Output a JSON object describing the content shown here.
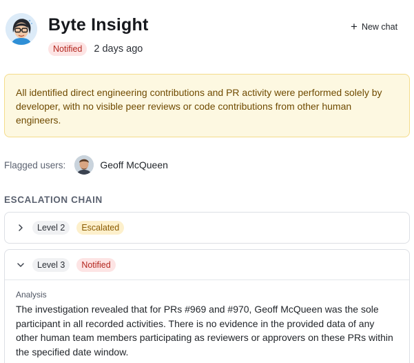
{
  "header": {
    "title": "Byte Insight",
    "status": "Notified",
    "time": "2 days ago",
    "new_chat_label": "New chat"
  },
  "alert": {
    "text": "All identified direct engineering contributions and PR activity were performed solely by developer, with no visible peer reviews or code contributions from other human engineers."
  },
  "flagged": {
    "label": "Flagged users:",
    "users": [
      {
        "name": "Geoff McQueen"
      }
    ]
  },
  "escalation": {
    "heading": "ESCALATION CHAIN",
    "levels": [
      {
        "label": "Level 2",
        "status": "Escalated",
        "expanded": false
      },
      {
        "label": "Level 3",
        "status": "Notified",
        "expanded": true,
        "analysis_label": "Analysis",
        "analysis_text": "The investigation revealed that for PRs #969 and #970, Geoff McQueen was the sole participant in all recorded activities. There is no evidence in the provided data of any other human team members participating as reviewers or approvers on these PRs within the specified date window."
      }
    ]
  },
  "colors": {
    "notified_bg": "#fde4e4",
    "notified_fg": "#b3261e",
    "escalated_bg": "#fdf0cc",
    "escalated_fg": "#8a5a00",
    "alert_bg": "#fdf8e1",
    "alert_border": "#f4dc8a"
  },
  "icons": [
    "bot-avatar",
    "plus-icon",
    "user-avatar",
    "chevron-right-icon",
    "chevron-down-icon"
  ]
}
